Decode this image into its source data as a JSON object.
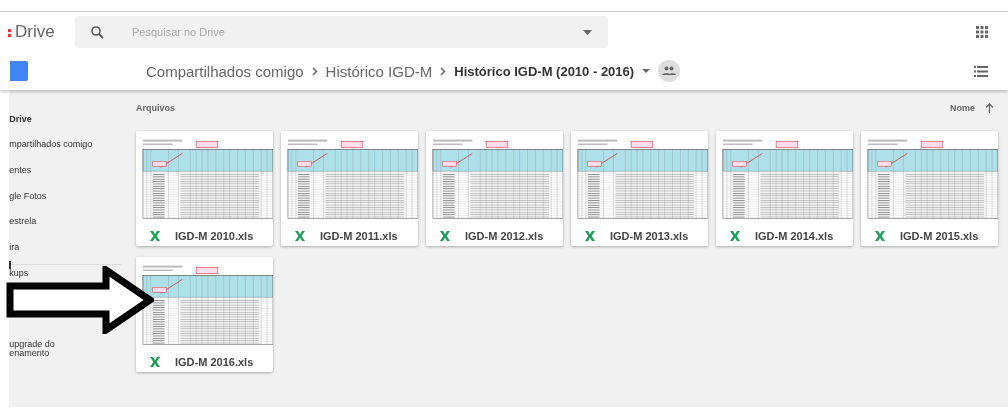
{
  "header": {
    "logo_text": "Drive",
    "search": {
      "placeholder": "Pesquisar no Drive"
    }
  },
  "breadcrumb": [
    {
      "label": "Compartilhados comigo",
      "selected": false
    },
    {
      "label": "Histórico IGD-M",
      "selected": false
    },
    {
      "label": "Histórico IGD-M (2010 - 2016)",
      "selected": true
    }
  ],
  "sidebar": {
    "items": [
      "Drive",
      "mpartilhados comigo",
      "entes",
      "gle Fotos",
      "estrela",
      "ira"
    ],
    "backups": "kups",
    "storage": [
      "upgrade do",
      "enamento"
    ]
  },
  "section_title": "Arquivos",
  "sort_label": "Nome",
  "files": [
    {
      "name": "IGD-M 2010.xls"
    },
    {
      "name": "IGD-M 2011.xls"
    },
    {
      "name": "IGD-M 2012.xls"
    },
    {
      "name": "IGD-M 2013.xls"
    },
    {
      "name": "IGD-M 2014.xls"
    },
    {
      "name": "IGD-M 2015.xls"
    },
    {
      "name": "IGD-M 2016.xls"
    }
  ]
}
